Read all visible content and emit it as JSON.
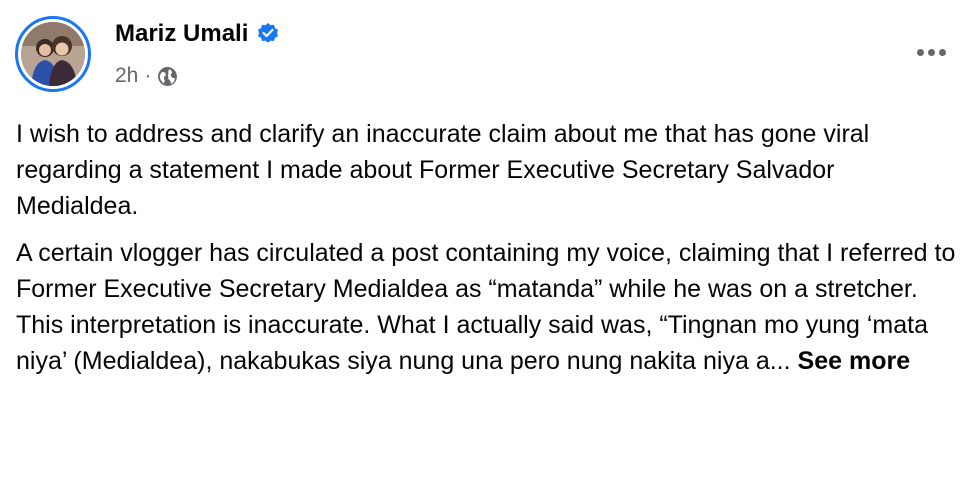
{
  "post": {
    "author": "Mariz Umali",
    "verified_icon": "verified-badge-icon",
    "timestamp": "2h",
    "separator": "·",
    "audience_icon": "globe-icon",
    "paragraph1": "I wish to address and clarify an inaccurate claim about me that has gone viral regarding a statement I made about Former Executive Secretary Salvador Medialdea.",
    "paragraph2": "A certain vlogger has circulated a post containing my voice, claiming that I referred to Former Executive Secretary Medialdea as “matanda” while he was on a stretcher. This interpretation is inaccurate. What I actually said was, “Tingnan mo yung ‘mata niya’ (Medialdea), nakabukas siya nung una pero nung nakita niya a...",
    "see_more": "See more",
    "more_icon": "more-options-icon",
    "accent_color": "#1877f2",
    "secondary_text_color": "#65676b"
  }
}
